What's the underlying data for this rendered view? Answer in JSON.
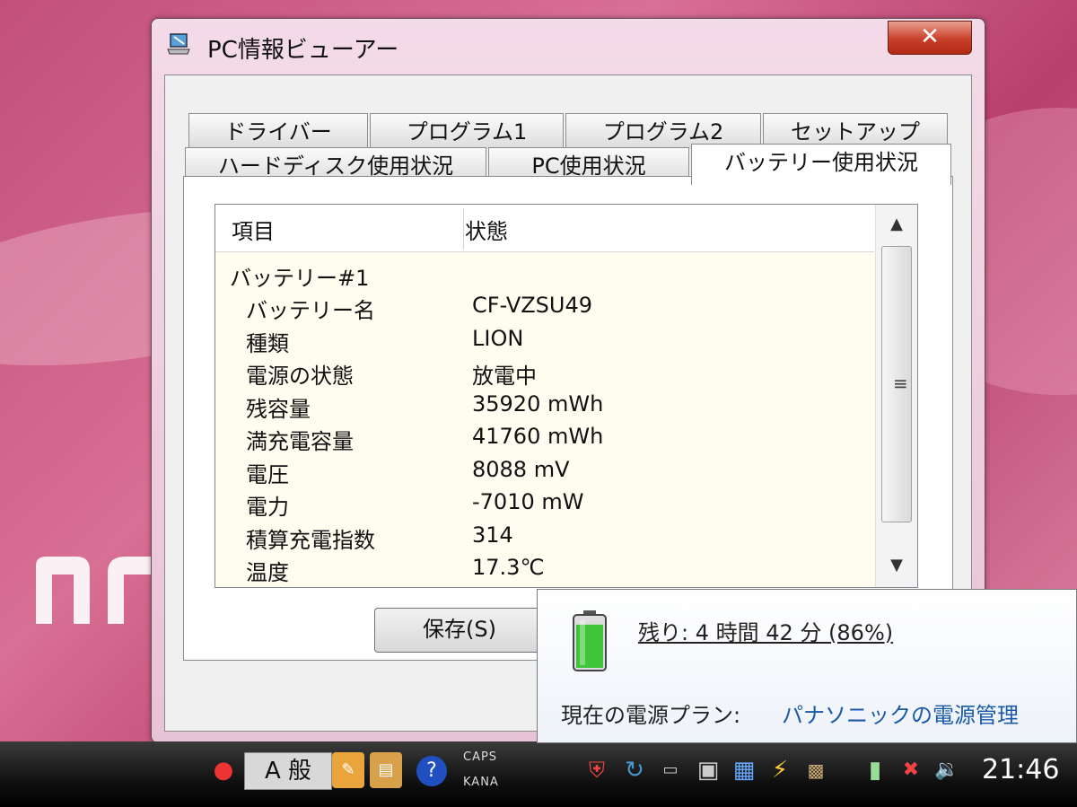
{
  "window": {
    "title": "PC情報ビューアー",
    "close_label": "✕"
  },
  "tabs_row1": [
    "ドライバー",
    "プログラム1",
    "プログラム2",
    "セットアップ"
  ],
  "tabs_row2": [
    "ハードディスク使用状況",
    "PC使用状況",
    "バッテリー使用状況"
  ],
  "active_tab": "バッテリー使用状況",
  "table": {
    "headers": [
      "項目",
      "状態"
    ],
    "group": "バッテリー#1",
    "rows": [
      {
        "label": "バッテリー名",
        "value": "CF-VZSU49"
      },
      {
        "label": "種類",
        "value": "LION"
      },
      {
        "label": "電源の状態",
        "value": "放電中"
      },
      {
        "label": "残容量",
        "value": "35920 mWh"
      },
      {
        "label": "満充電容量",
        "value": "41760 mWh"
      },
      {
        "label": "電圧",
        "value": "8088 mV"
      },
      {
        "label": "電力",
        "value": "-7010 mW"
      },
      {
        "label": "積算充電指数",
        "value": "314"
      },
      {
        "label": "温度",
        "value": "17.3℃"
      }
    ]
  },
  "save_button": "保存(S)",
  "battery_popup": {
    "remaining": "残り: 4 時間 42 分 (86%)",
    "charge_fraction": 0.86,
    "plan_label": "現在の電源プラン:",
    "plan_value": "パナソニックの電源管理"
  },
  "taskbar": {
    "ime_mode": "A",
    "ime_kanji": "般",
    "caps": "CAPS",
    "kana": "KANA",
    "help": "?",
    "clock": "21:46"
  },
  "colors": {
    "accent_link": "#1a5aa8",
    "close_red": "#c9402a",
    "battery_green": "#3fc53a"
  }
}
